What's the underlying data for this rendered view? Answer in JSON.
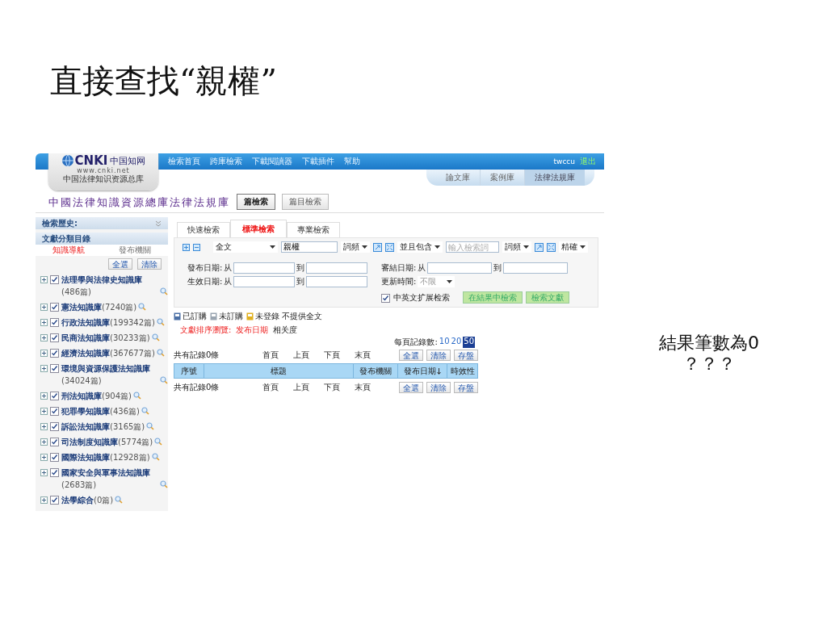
{
  "slide_title": "直接查找“親權”",
  "note": [
    "結果筆數為0",
    "？？？"
  ],
  "header": {
    "logo_mark": "CNKI",
    "logo_cn": "中国知网",
    "logo_url": "www.cnki.net",
    "logo_tagline": "中国法律知识资源总库",
    "nav": [
      "檢索首頁",
      "跨庫檢索",
      "下載閱讀器",
      "下載插件",
      "幫助"
    ],
    "user": "twccu",
    "logout": "退出",
    "db_tabs": [
      {
        "label": "論文庫",
        "selected": false
      },
      {
        "label": "案例庫",
        "selected": false
      },
      {
        "label": "法律法規庫",
        "selected": true
      }
    ]
  },
  "db_title": "中國法律知識資源總庫法律法規庫",
  "mode_buttons": [
    {
      "label": "篇檢索",
      "selected": true
    },
    {
      "label": "篇目檢索",
      "selected": false
    }
  ],
  "sidebar": {
    "history_label": "檢索歷史:",
    "catalog_label": "文獻分類目錄",
    "tabs": [
      {
        "label": "知識導航",
        "selected": true
      },
      {
        "label": "發布機關",
        "selected": false
      }
    ],
    "buttons": [
      "全選",
      "清除"
    ],
    "items": [
      {
        "text": "**法理學與法律史知識庫**(486篇)",
        "checked": true
      },
      {
        "text": "**憲法知識庫**(7240篇)",
        "checked": true
      },
      {
        "text": "**行政法知識庫**(199342篇)",
        "checked": true
      },
      {
        "text": "**民商法知識庫**(30233篇)",
        "checked": true
      },
      {
        "text": "**經濟法知識庫**(367677篇)",
        "checked": true
      },
      {
        "text": "**環境與資源保護法知識庫**(34024篇)",
        "checked": true
      },
      {
        "text": "**刑法知識庫**(904篇)",
        "checked": true
      },
      {
        "text": "**犯罪學知識庫**(436篇)",
        "checked": true
      },
      {
        "text": "**訴訟法知識庫**(3165篇)",
        "checked": true
      },
      {
        "text": "**司法制度知識庫**(5774篇)",
        "checked": true
      },
      {
        "text": "**國際法知識庫**(12928篇)",
        "checked": true
      },
      {
        "text": "**國家安全與軍事法知識庫**(2683篇)",
        "checked": true
      },
      {
        "text": "**法學綜合**(0篇)",
        "checked": true
      }
    ]
  },
  "search": {
    "tabs": [
      {
        "label": "快速檢索",
        "selected": false
      },
      {
        "label": "標準檢索",
        "selected": true
      },
      {
        "label": "專業檢索",
        "selected": false
      }
    ],
    "field": "全文",
    "term": "親權",
    "freq": "詞頻",
    "logic": "並且包含",
    "term2_placeholder": "輸入檢索詞",
    "freq2": "詞頻",
    "match": "精確",
    "dates": [
      {
        "label": "發布日期:",
        "from": "从",
        "to": "到"
      },
      {
        "label": "生效日期:",
        "from": "从",
        "to": "到"
      }
    ],
    "judged": {
      "label": "審結日期:",
      "from": "从",
      "to": "到"
    },
    "updated": {
      "label": "更新時間:",
      "value": "不限"
    },
    "expand": {
      "label": "中英文扩展检索",
      "checked": true
    },
    "buttons": [
      "在結果中檢索",
      "檢索文獻"
    ]
  },
  "results": {
    "legend": [
      {
        "label": "已訂購",
        "color": "#4a6fa5"
      },
      {
        "label": "未訂購",
        "color": "#9aa5b1"
      },
      {
        "label": "未登錄 不提供全文",
        "color": "#e0b020"
      }
    ],
    "sort": {
      "label": "文獻排序瀏覽:",
      "options": [
        {
          "label": "发布日期",
          "selected": true
        },
        {
          "label": "相关度",
          "selected": false
        }
      ]
    },
    "per_page": {
      "label": "每頁記錄數:",
      "options": [
        {
          "label": "10",
          "selected": false
        },
        {
          "label": "20",
          "selected": false
        },
        {
          "label": "50",
          "selected": true
        }
      ]
    },
    "pager_top": {
      "count": "共有記錄0條",
      "links": [
        "首頁",
        "上頁",
        "下頁",
        "末頁"
      ],
      "buttons": [
        "全選",
        "清除",
        "存盤"
      ]
    },
    "columns": [
      {
        "label": "序號",
        "sorted": false
      },
      {
        "label": "標題",
        "sorted": false
      },
      {
        "label": "發布機關",
        "sorted": false
      },
      {
        "label": "發布日期",
        "sorted": true
      },
      {
        "label": "時效性",
        "sorted": false
      }
    ],
    "pager_bottom": {
      "count": "共有記錄0條",
      "links": [
        "首頁",
        "上頁",
        "下頁",
        "末頁"
      ],
      "buttons": [
        "全選",
        "清除",
        "存盤"
      ]
    }
  }
}
